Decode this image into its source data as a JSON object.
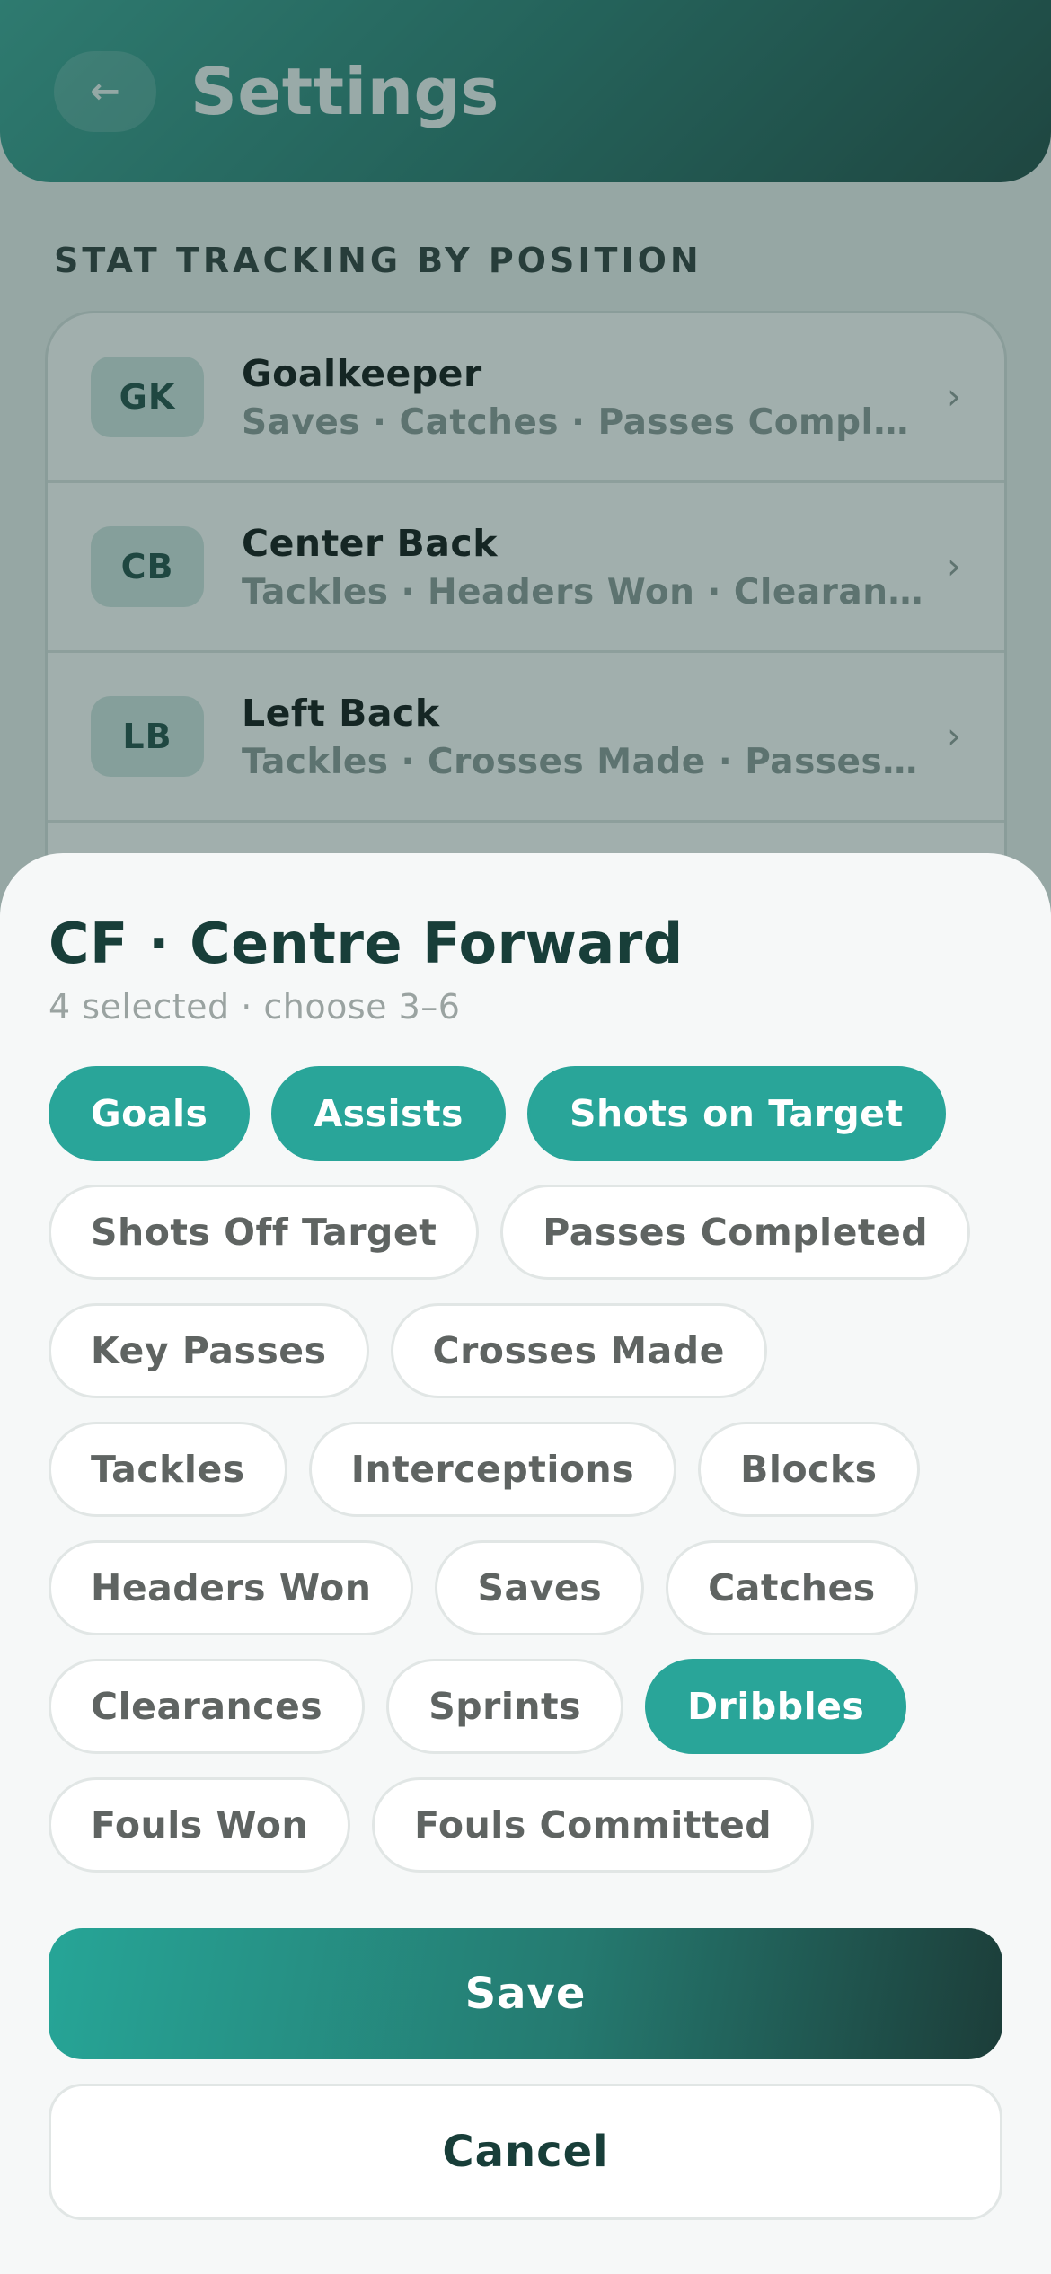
{
  "header": {
    "back_icon": "←",
    "title": "Settings"
  },
  "section": {
    "label": "STAT TRACKING BY POSITION"
  },
  "positions": [
    {
      "abbr": "GK",
      "name": "Goalkeeper",
      "stats": "Saves · Catches · Passes Compl…"
    },
    {
      "abbr": "CB",
      "name": "Center Back",
      "stats": "Tackles · Headers Won · Clearan…"
    },
    {
      "abbr": "LB",
      "name": "Left Back",
      "stats": "Tackles · Crosses Made · Passes …"
    }
  ],
  "chevron_icon": "›",
  "sheet": {
    "title": "CF · Centre Forward",
    "subtitle": "4 selected · choose 3–6",
    "chips": [
      {
        "label": "Goals",
        "selected": true
      },
      {
        "label": "Assists",
        "selected": true
      },
      {
        "label": "Shots on Target",
        "selected": true
      },
      {
        "label": "Shots Off Target",
        "selected": false
      },
      {
        "label": "Passes Completed",
        "selected": false
      },
      {
        "label": "Key Passes",
        "selected": false
      },
      {
        "label": "Crosses Made",
        "selected": false
      },
      {
        "label": "Tackles",
        "selected": false
      },
      {
        "label": "Interceptions",
        "selected": false
      },
      {
        "label": "Blocks",
        "selected": false
      },
      {
        "label": "Headers Won",
        "selected": false
      },
      {
        "label": "Saves",
        "selected": false
      },
      {
        "label": "Catches",
        "selected": false
      },
      {
        "label": "Clearances",
        "selected": false
      },
      {
        "label": "Sprints",
        "selected": false
      },
      {
        "label": "Dribbles",
        "selected": true
      },
      {
        "label": "Fouls Won",
        "selected": false
      },
      {
        "label": "Fouls Committed",
        "selected": false
      }
    ],
    "save_label": "Save",
    "cancel_label": "Cancel"
  },
  "colors": {
    "accent": "#29a599",
    "header_dark": "#1f4b45",
    "title_text": "#183e39"
  }
}
